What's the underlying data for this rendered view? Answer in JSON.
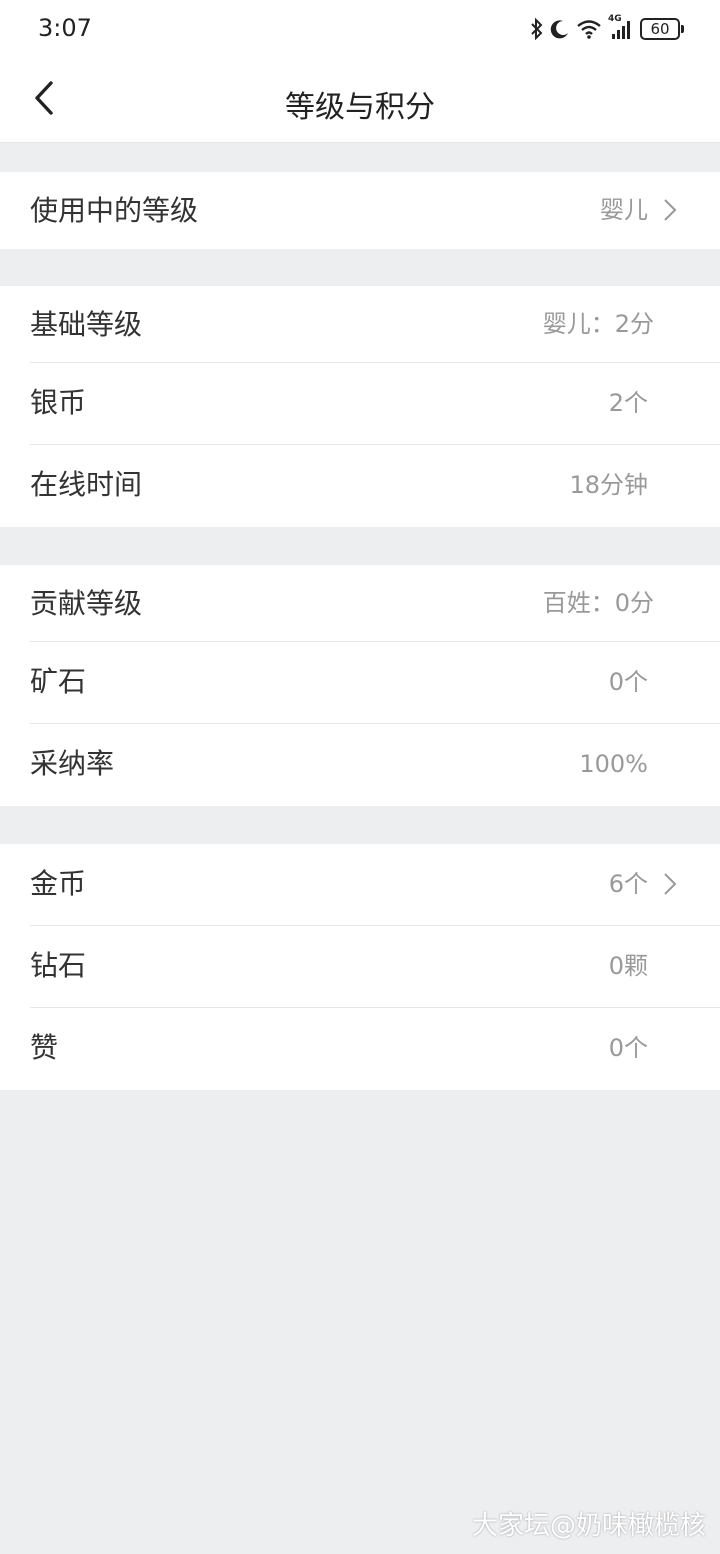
{
  "status_bar": {
    "time": "3:07",
    "icons": [
      "bluetooth-icon",
      "moon-icon",
      "wifi-icon",
      "signal-4g-icon",
      "battery-icon"
    ],
    "signal_label": "4G",
    "battery": "60"
  },
  "navbar": {
    "title": "等级与积分",
    "back_icon": "chevron-left-icon"
  },
  "sections": [
    {
      "rows": [
        {
          "label": "使用中的等级",
          "value": "婴儿",
          "has_chevron": true
        }
      ]
    },
    {
      "rows": [
        {
          "label": "基础等级",
          "value": "婴儿：2分",
          "has_chevron": false
        },
        {
          "label": "银币",
          "value": "2个",
          "has_chevron": false
        },
        {
          "label": "在线时间",
          "value": "18分钟",
          "has_chevron": false
        }
      ]
    },
    {
      "rows": [
        {
          "label": "贡献等级",
          "value": "百姓：0分",
          "has_chevron": false
        },
        {
          "label": "矿石",
          "value": "0个",
          "has_chevron": false
        },
        {
          "label": "采纳率",
          "value": "100%",
          "has_chevron": false
        }
      ]
    },
    {
      "rows": [
        {
          "label": "金币",
          "value": "6个",
          "has_chevron": true
        },
        {
          "label": "钻石",
          "value": "0颗",
          "has_chevron": false
        },
        {
          "label": "赞",
          "value": "0个",
          "has_chevron": false
        }
      ]
    }
  ],
  "watermark": "大家坛@奶味橄榄核",
  "colors": {
    "background": "#edeef0",
    "card": "#ffffff",
    "label": "#333333",
    "value": "#999999"
  }
}
